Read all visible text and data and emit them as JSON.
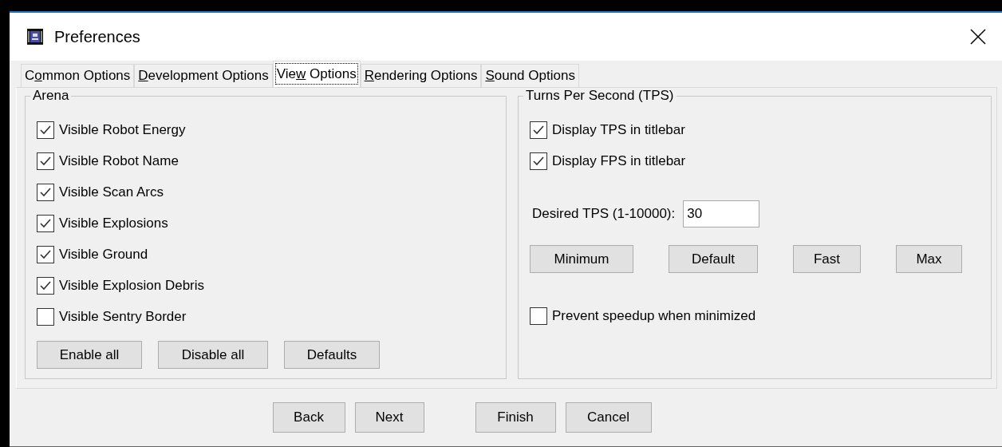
{
  "window": {
    "title": "Preferences"
  },
  "tabs": [
    {
      "before": "C",
      "mnemonic": "o",
      "after": "mmon Options",
      "selected": false
    },
    {
      "mnemonic": "D",
      "after": "evelopment Options",
      "selected": false
    },
    {
      "before": "Vie",
      "mnemonic": "w",
      "after": " Options",
      "selected": true
    },
    {
      "mnemonic": "R",
      "after": "endering Options",
      "selected": false
    },
    {
      "mnemonic": "S",
      "after": "ound Options",
      "selected": false
    }
  ],
  "arena": {
    "title": "Arena",
    "options": [
      {
        "label": "Visible Robot Energy",
        "checked": true
      },
      {
        "label": "Visible Robot Name",
        "checked": true
      },
      {
        "label": "Visible Scan Arcs",
        "checked": true
      },
      {
        "label": "Visible Explosions",
        "checked": true
      },
      {
        "label": "Visible Ground",
        "checked": true
      },
      {
        "label": "Visible Explosion Debris",
        "checked": true
      },
      {
        "label": "Visible Sentry Border",
        "checked": false
      }
    ],
    "buttons": [
      "Enable all",
      "Disable all",
      "Defaults"
    ]
  },
  "tps": {
    "title": "Turns Per Second (TPS)",
    "options": [
      {
        "label": "Display TPS in titlebar",
        "checked": true
      },
      {
        "label": "Display FPS in titlebar",
        "checked": true
      }
    ],
    "desired_label": "Desired TPS (1-10000):",
    "desired_value": "30",
    "buttons": [
      "Minimum",
      "Default",
      "Fast",
      "Max"
    ],
    "prevent": {
      "label": "Prevent speedup when minimized",
      "checked": false
    }
  },
  "footer_buttons": [
    "Back",
    "Next",
    "Finish",
    "Cancel"
  ]
}
